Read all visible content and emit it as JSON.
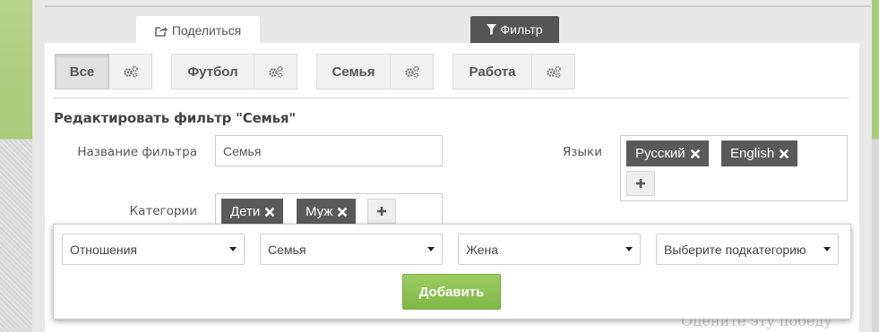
{
  "top_tabs": {
    "share_label": "Поделиться",
    "filter_label": "Фильтр"
  },
  "filter_groups": [
    {
      "label": "Все",
      "active": true
    },
    {
      "label": "Футбол",
      "active": false
    },
    {
      "label": "Семья",
      "active": false
    },
    {
      "label": "Работа",
      "active": false
    }
  ],
  "edit_form": {
    "title": "Редактировать фильтр \"Семья\"",
    "name_label": "Название фильтра",
    "name_value": "Семья",
    "categories_label": "Категории",
    "categories": [
      "Дети",
      "Муж"
    ],
    "languages_label": "Языки",
    "languages": [
      "Русский",
      "English"
    ]
  },
  "category_picker": {
    "selects": [
      "Отношения",
      "Семья",
      "Жена",
      "Выберите подкатегорию"
    ],
    "add_label": "Добавить"
  },
  "background_text": "Оцените эту победу",
  "colors": {
    "accent_green": "#8cc152",
    "tag_gray": "#5a5a5a",
    "filter_tab": "#555555"
  },
  "icons": {
    "share": "share-icon",
    "filter": "filter-icon",
    "settings": "gears-icon",
    "remove": "close-icon",
    "add": "plus-icon"
  }
}
